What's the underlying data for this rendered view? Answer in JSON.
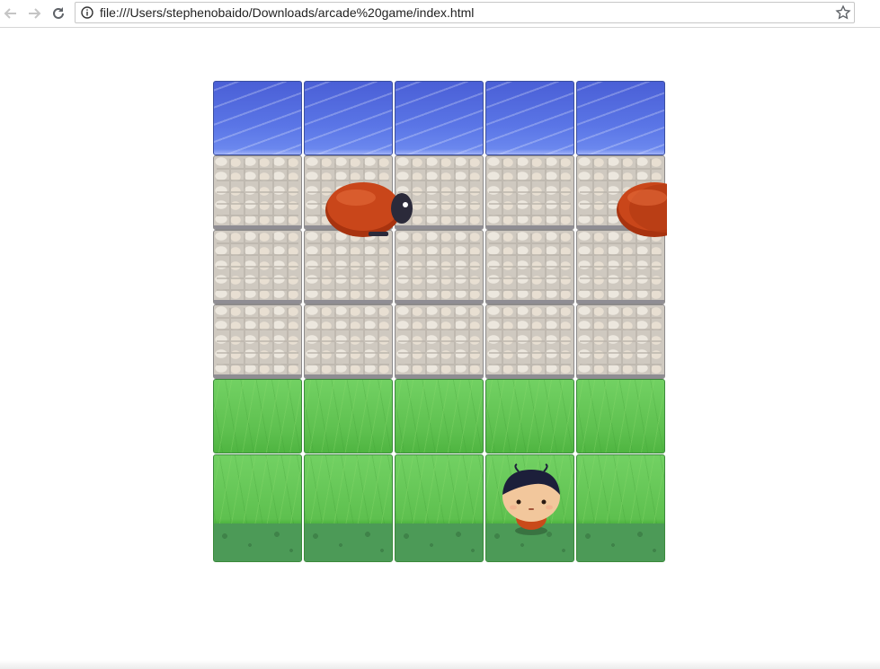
{
  "browser": {
    "url": "file:///Users/stephenobaido/Downloads/arcade%20game/index.html",
    "back_icon": "back-arrow-icon",
    "forward_icon": "forward-arrow-icon",
    "reload_icon": "reload-icon",
    "info_icon": "info-icon",
    "bookmark_icon": "star-icon"
  },
  "game": {
    "columns": 5,
    "rows": [
      "water",
      "stone",
      "stone",
      "stone",
      "grass",
      "grass"
    ],
    "player": {
      "character": "boy",
      "row": 6,
      "column": 4
    },
    "enemies": [
      {
        "type": "bug",
        "color": "#c23a12",
        "row": 2,
        "column": 2
      },
      {
        "type": "bug",
        "color": "#c23a12",
        "row": 2,
        "column": 5
      }
    ]
  }
}
